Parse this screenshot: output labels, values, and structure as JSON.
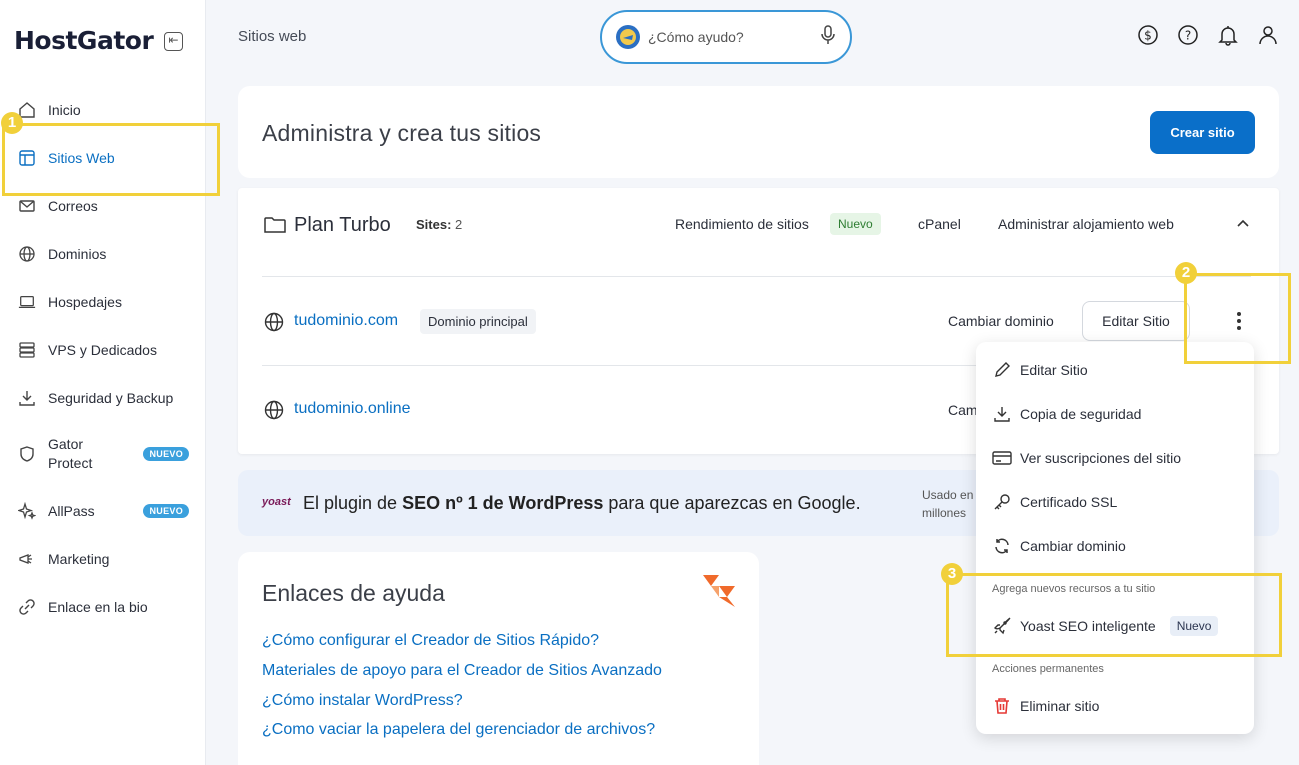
{
  "brand": {
    "logo_text": "HostGator",
    "primary_color": "#0a6fc9",
    "highlight_color": "#f1d03a"
  },
  "sidebar": {
    "items": [
      {
        "label": "Inicio",
        "icon": "home-icon"
      },
      {
        "label": "Sitios Web",
        "icon": "layout-icon",
        "active": true
      },
      {
        "label": "Correos",
        "icon": "mail-icon"
      },
      {
        "label": "Dominios",
        "icon": "globe-icon"
      },
      {
        "label": "Hospedajes",
        "icon": "laptop-icon"
      },
      {
        "label": "VPS y Dedicados",
        "icon": "server-icon"
      },
      {
        "label": "Seguridad y Backup",
        "icon": "download-icon"
      },
      {
        "label": "Gator",
        "label2": "Protect",
        "icon": "shield-icon",
        "badge": "NUEVO"
      },
      {
        "label": "AllPass",
        "icon": "sparkle-icon",
        "badge": "NUEVO"
      },
      {
        "label": "Marketing",
        "icon": "megaphone-icon"
      },
      {
        "label": "Enlace en la bio",
        "icon": "link-icon"
      }
    ]
  },
  "header": {
    "title": "Sitios web",
    "search_placeholder": "¿Cómo ayudo?",
    "icons": [
      "dollar-icon",
      "help-icon",
      "bell-icon",
      "user-icon"
    ]
  },
  "main": {
    "heading": "Administra y crea tus sitios",
    "create_button": "Crear sitio",
    "plan": {
      "name": "Plan Turbo",
      "sites_label": "Sites:",
      "sites_count": "2",
      "performance": "Rendimiento de sitios",
      "performance_badge": "Nuevo",
      "cpanel": "cPanel",
      "manage_hosting": "Administrar alojamiento web"
    },
    "sites": [
      {
        "domain": "tudominio.com",
        "tag": "Dominio principal",
        "change_domain": "Cambiar dominio",
        "edit_button": "Editar Sitio"
      },
      {
        "domain": "tudominio.online",
        "change_domain_partial": "Cam"
      }
    ],
    "yoast": {
      "logo": "yoast",
      "text_pre": "El plugin de ",
      "text_bold": "SEO nº 1 de WordPress",
      "text_post": " para que aparezcas en Google.",
      "side_line1": "Usado en",
      "side_line2": "millones"
    },
    "help": {
      "heading": "Enlaces de ayuda",
      "links": [
        "¿Cómo configurar el Creador de Sitios Rápido?",
        "Materiales de apoyo para el Creador de Sitios Avanzado",
        "¿Cómo instalar WordPress?",
        "¿Como vaciar la papelera del gerenciador de archivos?"
      ]
    }
  },
  "dropdown": {
    "items": [
      {
        "label": "Editar Sitio",
        "icon": "pencil-icon"
      },
      {
        "label": "Copia de seguridad",
        "icon": "download-icon"
      },
      {
        "label": "Ver suscripciones del sitio",
        "icon": "credit-card-icon"
      },
      {
        "label": "Certificado SSL",
        "icon": "key-icon"
      },
      {
        "label": "Cambiar dominio",
        "icon": "refresh-icon"
      }
    ],
    "section_new": "Agrega nuevos recursos a tu sitio",
    "yoast_item": "Yoast SEO inteligente",
    "yoast_badge": "Nuevo",
    "section_permanent": "Acciones permanentes",
    "delete_item": "Eliminar sitio"
  },
  "annotations": [
    "1",
    "2",
    "3"
  ]
}
